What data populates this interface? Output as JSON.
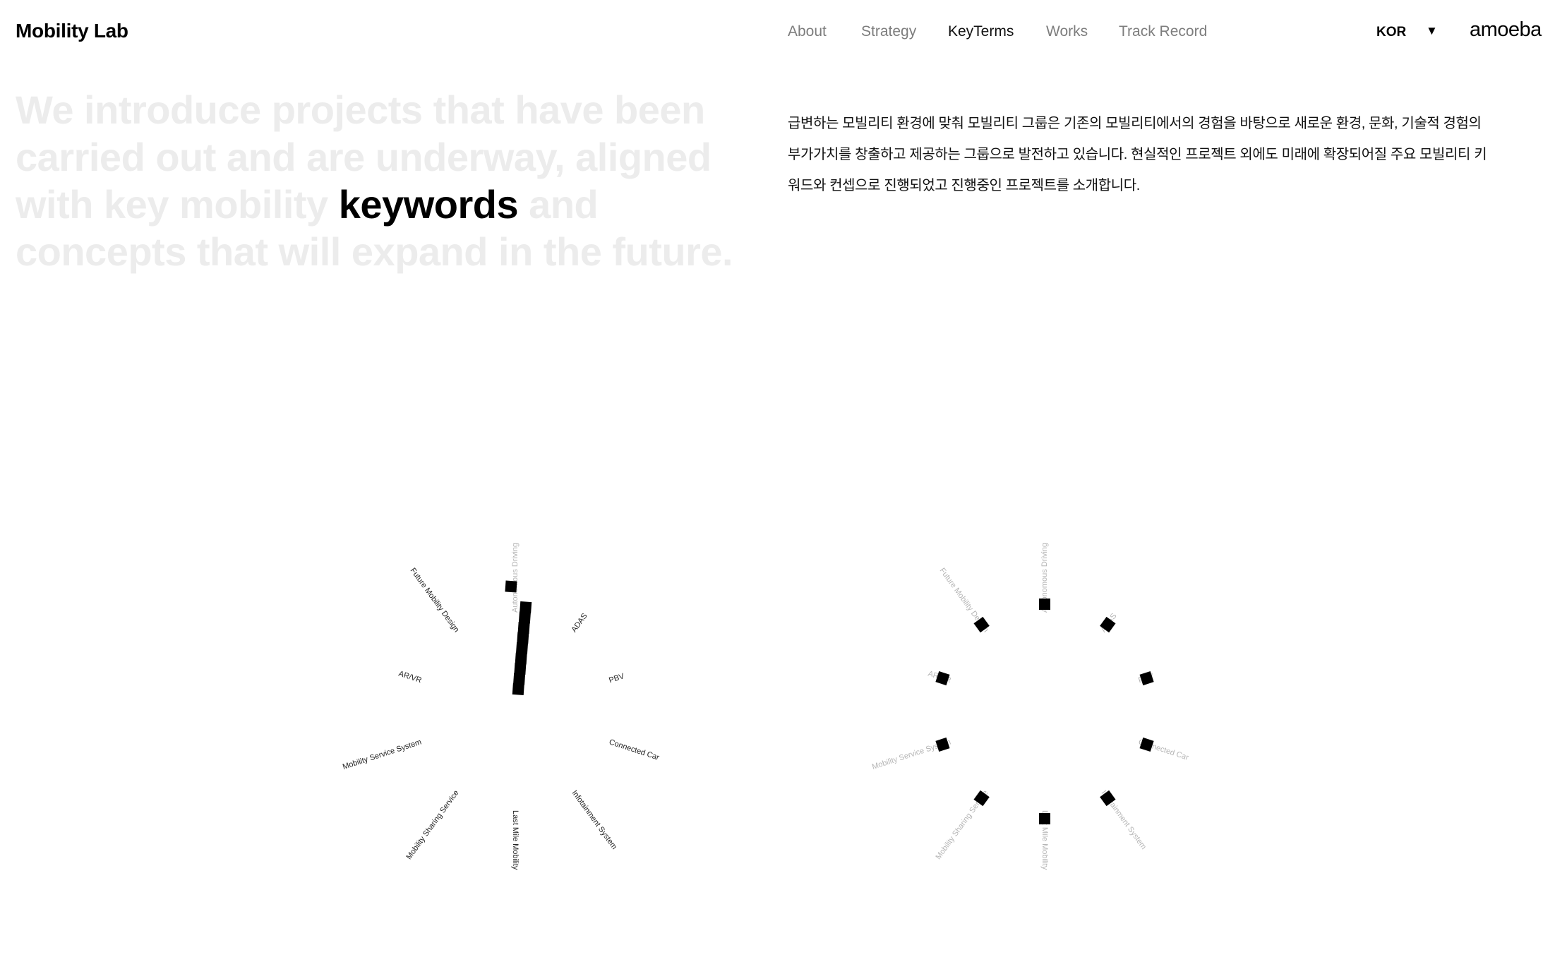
{
  "header": {
    "logo": "Mobility Lab",
    "nav": [
      {
        "label": "About",
        "active": false
      },
      {
        "label": "Strategy",
        "active": false
      },
      {
        "label": "KeyTerms",
        "active": true
      },
      {
        "label": "Works",
        "active": false
      },
      {
        "label": "Track Record",
        "active": false
      }
    ],
    "language": "KOR",
    "language_caret": "▼",
    "brand": "amoeba"
  },
  "intro": {
    "headline_before": "We introduce projects that have been carried out and are underway, aligned with key mobility ",
    "headline_highlight": "keywords",
    "headline_after": " and concepts that will expand in the future.",
    "description": "급변하는 모빌리티 환경에 맞춰 모빌리티 그룹은 기존의 모빌리티에서의 경험을 바탕으로 새로운 환경, 문화, 기술적 경험의 부가가치를 창출하고 제공하는 그룹으로 발전하고 있습니다. 현실적인 프로젝트 외에도 미래에 확장되어질 주요 모빌리티 키워드와 컨셉으로 진행되었고 진행중인 프로젝트를 소개합니다."
  },
  "keywords": [
    "Autonomous Driving",
    "ADAS",
    "PBV",
    "Connected Car",
    "Infotainment System",
    "Last Mile Mobility",
    "Mobility Sharing Service",
    "Mobility Service System",
    "AR/VR",
    "Future Mobility Design"
  ],
  "colors": {
    "text": "#000000",
    "nav_inactive": "#7d7d7d",
    "headline_faded": "#ececec",
    "label_faded": "#b5b5b5",
    "marker": "#000000"
  }
}
